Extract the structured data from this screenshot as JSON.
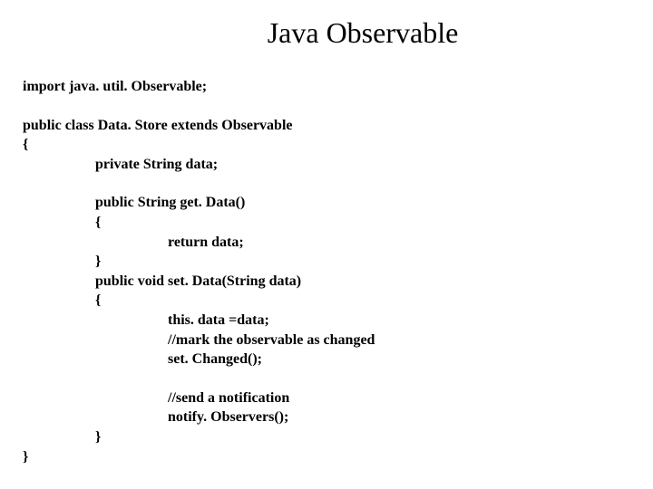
{
  "title": "Java Observable",
  "code": {
    "line1": "import java. util. Observable;",
    "line2": "public class Data. Store extends Observable",
    "line3": "{",
    "line4": "private String data;",
    "line5": "public String get. Data()",
    "line6": "{",
    "line7": "return data;",
    "line8": "}",
    "line9": "public void set. Data(String data)",
    "line10": "{",
    "line11": "this. data =data;",
    "line12": "//mark the observable as changed",
    "line13": "set. Changed();",
    "line14": "//send a notification",
    "line15": "notify. Observers();",
    "line16": "}",
    "line17": "}"
  }
}
